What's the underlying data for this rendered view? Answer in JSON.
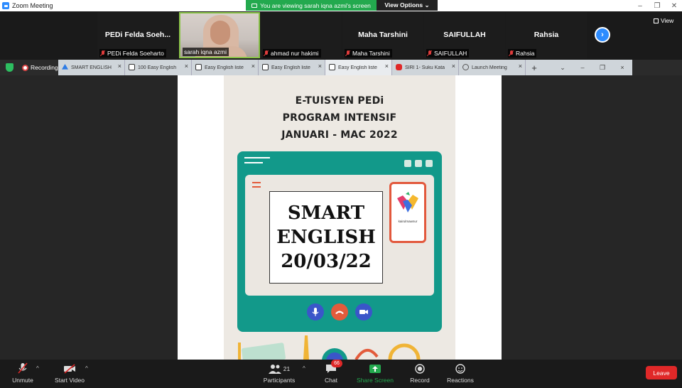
{
  "window": {
    "title": "Zoom Meeting"
  },
  "banner": {
    "viewing": "You are viewing sarah iqna azmi's screen",
    "view_options": "View Options ⌄"
  },
  "gallery": {
    "tiles": [
      {
        "big": "PEDi  Felda  Soeh...",
        "small": "PEDi Felda Soeharto"
      },
      {
        "big": "",
        "small": "sarah iqna azmi"
      },
      {
        "big": "",
        "small": "ahmad nur hakimi"
      },
      {
        "big": "Maha Tarshini",
        "small": "Maha Tarshini"
      },
      {
        "big": "SAIFULLAH",
        "small": "SAIFULLAH"
      },
      {
        "big": "Rahsia",
        "small": "Rahsia"
      }
    ],
    "next": "›",
    "view": "View"
  },
  "recording": {
    "label": "Recording"
  },
  "browser": {
    "tabs": [
      {
        "label": "SMART ENGLISH",
        "color": "#2d7be5"
      },
      {
        "label": "100 Easy English",
        "color": "#3a3a3a"
      },
      {
        "label": "Easy English liste",
        "color": "#3a3a3a"
      },
      {
        "label": "Easy English liste",
        "color": "#3a3a3a"
      },
      {
        "label": "Easy English liste",
        "color": "#3a3a3a"
      },
      {
        "label": "SIRI 1- Suku Kata",
        "color": "#e02828"
      },
      {
        "label": "Launch Meeting",
        "color": "#666"
      }
    ],
    "close": "×",
    "new_tab": "+",
    "controls": [
      "⌄",
      "–",
      "❐",
      "×"
    ]
  },
  "poster": {
    "line1": "E-TUISYEN PEDi",
    "line2": "PROGRAM INTENSIF",
    "line3": "JANUARI - MAC 2022",
    "box1": "SMART",
    "box2": "ENGLISH",
    "box3": "20/03/22",
    "brand": "kairulmawnur"
  },
  "toolbar": {
    "unmute": "Unmute",
    "start_video": "Start Video",
    "participants": "Participants",
    "participants_count": "21",
    "chat": "Chat",
    "chat_badge": "66",
    "share_screen": "Share Screen",
    "record": "Record",
    "reactions": "Reactions",
    "leave": "Leave"
  },
  "colors": {
    "accent": "#2D8CFF",
    "share_green": "#23A94E",
    "leave_red": "#E02828",
    "poster_teal": "#12998A"
  }
}
